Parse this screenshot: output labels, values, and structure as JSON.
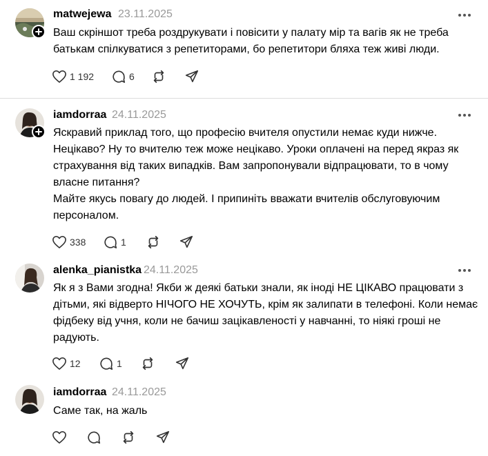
{
  "posts": [
    {
      "username": "matwejewa",
      "date": "23.11.2025",
      "text": "Ваш скріншот треба роздрукувати і повісити у палату мір та вагів як не треба батькам спілкуватися з репетиторами, бо репетитори бляха теж живі люди.",
      "likes": "1 192",
      "comments": "6"
    },
    {
      "username": "iamdorraa",
      "date": "24.11.2025",
      "text": "Яскравий приклад того, що професію вчителя опустили немає куди нижче.\nНецікаво? Ну то вчителю теж може нецікаво. Уроки оплачені на перед якраз як страхування від таких випадків. Вам запропонували відпрацювати, то в чому власне питання?\nМайте якусь повагу до людей. І припиніть вважати вчителів обслуговуючим персоналом.",
      "likes": "338",
      "comments": "1"
    },
    {
      "username": "alenka_pianistka",
      "date": "24.11.2025",
      "text": "Як я з Вами згодна! Якби ж деякі батьки знали, як іноді НЕ ЦІКАВО працювати з дітьми, які відверто НІЧОГО НЕ ХОЧУТЬ, крім як залипати в телефоні. Коли немає фідбеку від учня, коли не бачиш зацікавленості у навчанні, то ніякі гроші не радують.",
      "likes": "12",
      "comments": "1"
    },
    {
      "username": "iamdorraa",
      "date": "24.11.2025",
      "text": "Саме так, на жаль",
      "likes": "",
      "comments": ""
    }
  ],
  "icons": {
    "like": "heart-icon",
    "comment": "comment-icon",
    "repost": "repost-icon",
    "share": "share-icon",
    "more": "more-icon",
    "follow": "plus-icon"
  },
  "colors": {
    "date": "#999999",
    "divider": "#dcdcdc"
  }
}
